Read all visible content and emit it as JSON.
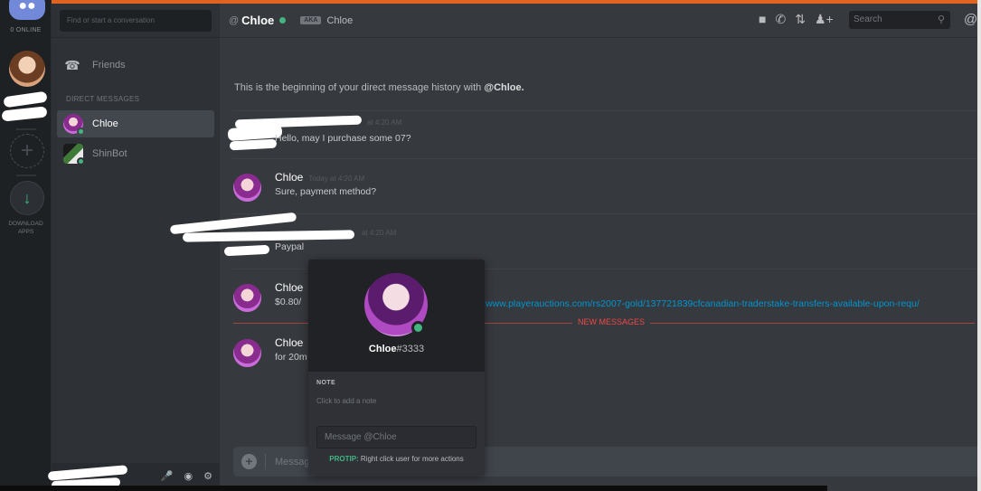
{
  "servers": {
    "online_label": "0 ONLINE",
    "download_label_line1": "DOWNLOAD",
    "download_label_line2": "APPS"
  },
  "sidebar": {
    "search_placeholder": "Find or start a conversation",
    "friends_label": "Friends",
    "dm_header": "DIRECT MESSAGES",
    "dms": [
      {
        "name": "Chloe",
        "active": true
      },
      {
        "name": "ShinBot",
        "active": false
      }
    ]
  },
  "header": {
    "at": "@",
    "title": "Chloe",
    "aka_badge": "AKA",
    "aka_name": "Chloe",
    "search_placeholder": "Search",
    "mention_icon": "@"
  },
  "chat": {
    "beginning_prefix": "This is the beginning of your direct message history with ",
    "beginning_user": "@Chloe.",
    "messages": [
      {
        "author": "",
        "time": "at 4:20 AM",
        "text": "Hello, may I purchase some 07?"
      },
      {
        "author": "Chloe",
        "time": "Today at 4:20 AM",
        "text": "Sure, payment method?"
      },
      {
        "author": "",
        "time": "at 4:20 AM",
        "text": "Paypal"
      },
      {
        "author": "Chloe",
        "time": "",
        "text": "$0.80/"
      },
      {
        "author": "Chloe",
        "time": "",
        "text": "for 20m"
      }
    ],
    "link": "www.playerauctions.com/rs2007-gold/137721839cfcanadian-traderstake-transfers-available-upon-requ/",
    "new_messages_label": "NEW MESSAGES",
    "composer_placeholder": "Messag"
  },
  "popout": {
    "name": "Chloe",
    "tag": "#3333",
    "note_header": "NOTE",
    "note_placeholder": "Click to add a note",
    "message_placeholder": "Message @Chloe",
    "protip_label": "PROTIP:",
    "protip_text": " Right click user for more actions"
  },
  "colors": {
    "accent": "#7289da",
    "online": "#43b581",
    "link": "#0096cf",
    "new_messages": "#f04747",
    "top_strip": "#e0631f"
  }
}
